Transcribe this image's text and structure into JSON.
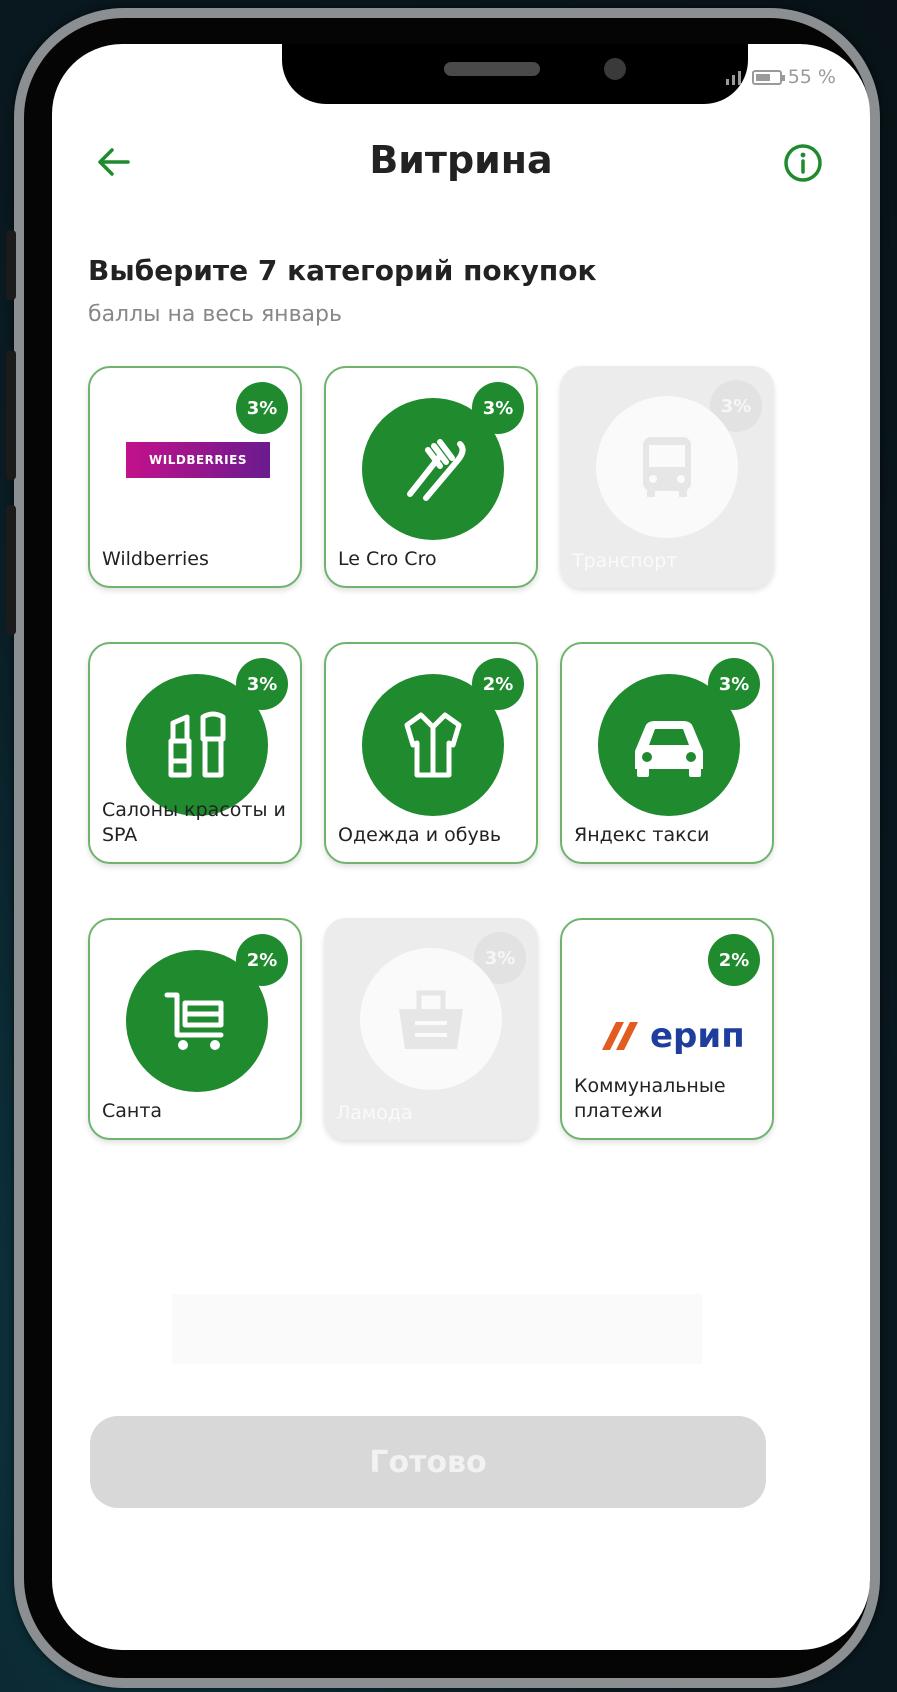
{
  "status_bar": {
    "battery": "55 %"
  },
  "header": {
    "title": "Витрина"
  },
  "content": {
    "heading": "Выберите 7 категорий покупок",
    "subheading": "баллы на весь январь"
  },
  "tiles": [
    {
      "label": "Wildberries",
      "percent": "3%",
      "logo_text": "WILDBERRIES",
      "icon": "wildberries-logo",
      "disabled": false
    },
    {
      "label": "Le Cro Cro",
      "percent": "3%",
      "icon": "fork-knife-icon",
      "disabled": false
    },
    {
      "label": "Транспорт",
      "percent": "3%",
      "icon": "bus-icon",
      "disabled": true
    },
    {
      "label": "Салоны красоты и SPA",
      "percent": "3%",
      "icon": "cosmetics-icon",
      "disabled": false
    },
    {
      "label": "Одежда и обувь",
      "percent": "2%",
      "icon": "clothing-icon",
      "disabled": false
    },
    {
      "label": "Яндекс такси",
      "percent": "3%",
      "icon": "car-icon",
      "disabled": false
    },
    {
      "label": "Санта",
      "percent": "2%",
      "icon": "shopping-cart-icon",
      "disabled": false
    },
    {
      "label": "Ламода",
      "percent": "3%",
      "icon": "basket-icon",
      "disabled": true
    },
    {
      "label": "Коммунальные платежи",
      "percent": "2%",
      "logo_text": "ерип",
      "icon": "erip-logo",
      "disabled": false
    }
  ],
  "footer": {
    "done_label": "Готово"
  },
  "colors": {
    "accent": "#1f8a2e",
    "disabled": "#ececec"
  }
}
